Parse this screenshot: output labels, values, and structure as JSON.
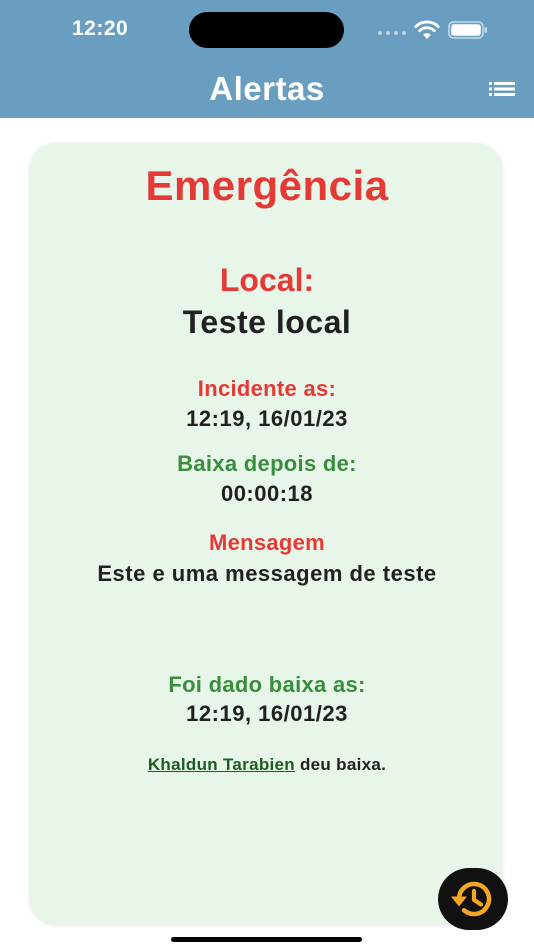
{
  "status_bar": {
    "time": "12:20"
  },
  "header": {
    "title": "Alertas",
    "menu_icon": "list-menu-icon",
    "background_color": "#6a9ec0"
  },
  "alert": {
    "type_label": "Emergência",
    "location_label": "Local:",
    "location_value": "Teste local",
    "incident_label": "Incidente as:",
    "incident_value": "12:19, 16/01/23",
    "elapsed_label": "Baixa depois de:",
    "elapsed_value": "00:00:18",
    "message_label": "Mensagem",
    "message_value": "Este e uma messagem de teste",
    "resolved_label": "Foi dado baixa as:",
    "resolved_value": "12:19, 16/01/23",
    "resolved_by_name": "Khaldun Tarabien",
    "resolved_by_suffix": " deu baixa."
  },
  "fab": {
    "icon": "history-icon",
    "accent_color": "#f5a623"
  },
  "colors": {
    "card_background": "#e8f5e9",
    "alert_red": "#e53935",
    "ok_green": "#388e3c"
  }
}
